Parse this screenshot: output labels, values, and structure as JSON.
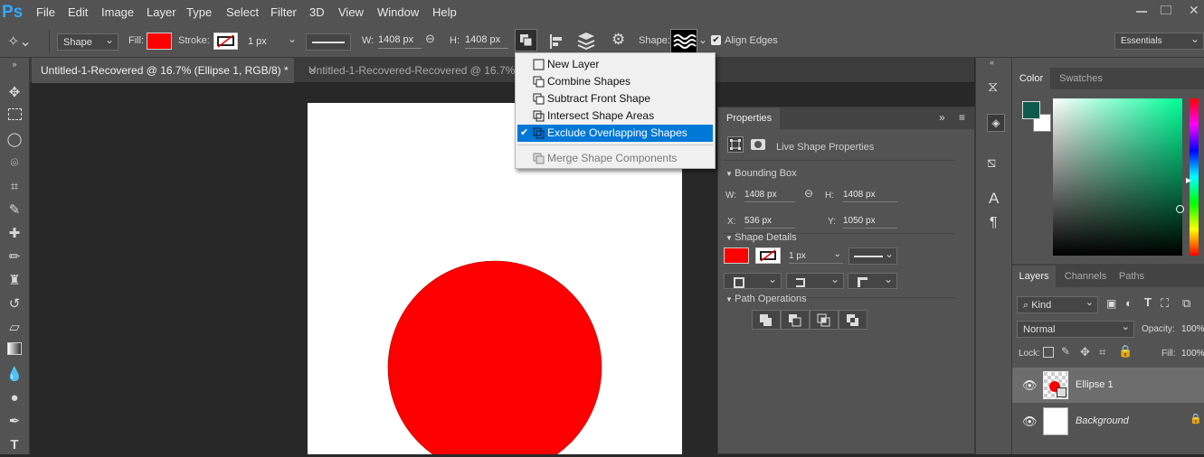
{
  "app": {
    "logo": "Ps"
  },
  "menu": [
    "File",
    "Edit",
    "Image",
    "Layer",
    "Type",
    "Select",
    "Filter",
    "3D",
    "View",
    "Window",
    "Help"
  ],
  "options": {
    "tool_mode": "Shape",
    "fill_label": "Fill:",
    "fill_color": "#ff0000",
    "stroke_label": "Stroke:",
    "stroke_width": "1 px",
    "w_label": "W:",
    "w_value": "1408 px",
    "h_label": "H:",
    "h_value": "1408 px",
    "shape_label": "Shape:",
    "align_edges": "Align Edges",
    "workspace": "Essentials"
  },
  "tabs": [
    {
      "label": "Untitled-1-Recovered @ 16.7% (Ellipse 1, RGB/8) *",
      "close": "×"
    },
    {
      "label": "Untitled-1-Recovered-Recovered @ 16.7% (E"
    }
  ],
  "path_ops_menu": {
    "items": [
      {
        "label": "New Layer",
        "icon": "new-layer-icon",
        "state": "normal"
      },
      {
        "label": "Combine Shapes",
        "icon": "combine-shapes-icon",
        "state": "normal"
      },
      {
        "label": "Subtract Front Shape",
        "icon": "subtract-front-shape-icon",
        "state": "normal"
      },
      {
        "label": "Intersect Shape Areas",
        "icon": "intersect-shape-areas-icon",
        "state": "normal"
      },
      {
        "label": "Exclude Overlapping Shapes",
        "icon": "exclude-overlapping-shapes-icon",
        "state": "selected"
      },
      {
        "label": "Merge Shape Components",
        "icon": "merge-shape-components-icon",
        "state": "disabled"
      }
    ],
    "checkmark": "✔"
  },
  "properties": {
    "title": "Properties",
    "subtitle": "Live Shape Properties",
    "bounding_box": "Bounding Box",
    "w_label": "W:",
    "w": "1408 px",
    "h_label": "H:",
    "h": "1408 px",
    "x_label": "X:",
    "x": "536 px",
    "y_label": "Y:",
    "y": "1050 px",
    "shape_details": "Shape Details",
    "stroke_width": "1 px",
    "path_operations": "Path Operations",
    "fill_color": "#ff0000"
  },
  "color_panel": {
    "tabs": [
      "Color",
      "Swatches"
    ],
    "foreground": "#0d5b4f",
    "background": "#ffffff",
    "hue": "#00ff99"
  },
  "layers_panel": {
    "tabs": [
      "Layers",
      "Channels",
      "Paths"
    ],
    "filter_kind": "Kind",
    "blend_mode": "Normal",
    "opacity_label": "Opacity:",
    "opacity": "100%",
    "lock_label": "Lock:",
    "fill_label": "Fill:",
    "fill": "100%",
    "layers": [
      {
        "name": "Ellipse 1",
        "selected": true
      },
      {
        "name": "Background",
        "selected": false
      }
    ]
  },
  "canvas": {
    "shape_color": "#ff0000"
  }
}
